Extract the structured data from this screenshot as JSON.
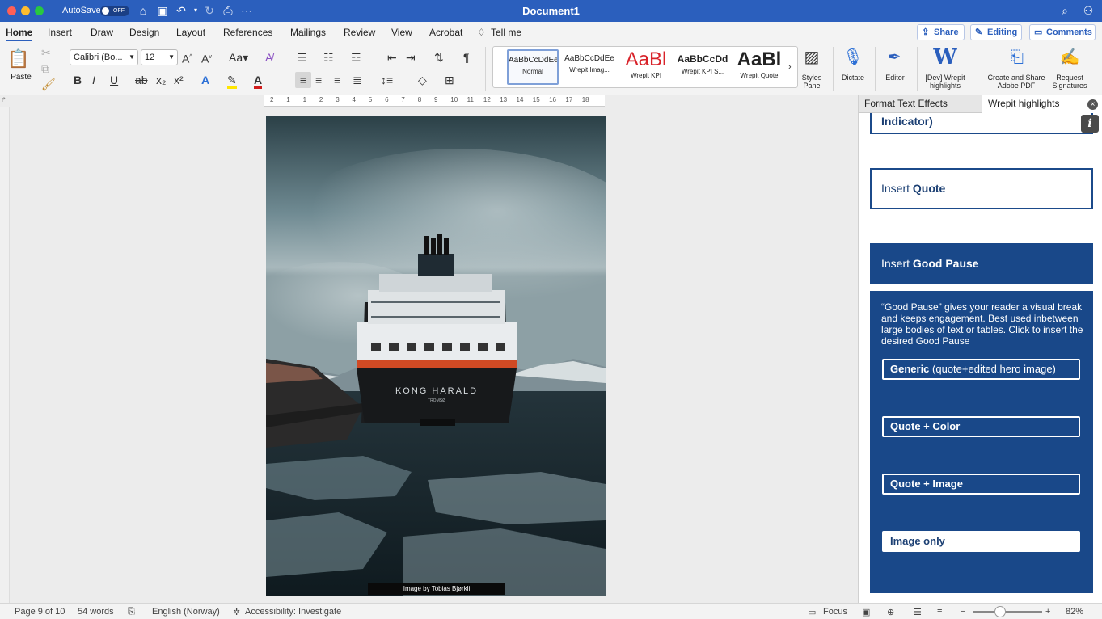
{
  "window": {
    "title": "Document1",
    "autosave_label": "AutoSave",
    "autosave_state": "OFF"
  },
  "ribbon_tabs": [
    "Home",
    "Insert",
    "Draw",
    "Design",
    "Layout",
    "References",
    "Mailings",
    "Review",
    "View",
    "Acrobat"
  ],
  "tell_me": "Tell me",
  "top_buttons": {
    "share": "Share",
    "editing": "Editing",
    "comments": "Comments"
  },
  "ribbon": {
    "paste": "Paste",
    "font_name": "Calibri (Bo...",
    "font_size": "12",
    "styles": [
      {
        "sample": "AaBbCcDdEe",
        "name": "Normal"
      },
      {
        "sample": "AaBbCcDdEe",
        "name": "Wrepit Imag..."
      },
      {
        "sample": "AaBl",
        "name": "Wrepit KPI"
      },
      {
        "sample": "AaBbCcDd",
        "name": "Wrepit KPI S..."
      },
      {
        "sample": "AaBl",
        "name": "Wrepit Quote"
      }
    ],
    "styles_pane": "Styles Pane",
    "dictate": "Dictate",
    "editor": "Editor",
    "dev_wrepit": "[Dev] Wrepit highlights",
    "create_pdf": "Create and Share Adobe PDF",
    "request_sig": "Request Signatures"
  },
  "ruler_numbers": [
    "2",
    "1",
    "1",
    "2",
    "3",
    "4",
    "5",
    "6",
    "7",
    "8",
    "9",
    "10",
    "11",
    "12",
    "13",
    "14",
    "15",
    "16",
    "17",
    "18"
  ],
  "document": {
    "ship_name": "KONG HARALD",
    "ship_port": "TROMSØ",
    "caption": "Image by Tobias Bjørkli"
  },
  "pane": {
    "tab_format": "Format Text Effects",
    "tab_wrepit": "Wrepit highlights",
    "indicator": "Indicator)",
    "quote_prefix": "Insert ",
    "quote_bold": "Quote",
    "pause_prefix": "Insert ",
    "pause_bold": "Good Pause",
    "description": "“Good Pause” gives your reader a visual break and keeps engagement. Best used inbetween large bodies of text or tables. Click to insert the desired Good Pause",
    "opt_generic_bold": "Generic",
    "opt_generic_rest": " (quote+edited hero image)",
    "opt_quote_color": "Quote + Color",
    "opt_quote_image": "Quote + Image",
    "opt_image_only": "Image only",
    "info": "i"
  },
  "status": {
    "page": "Page 9 of 10",
    "words": "54 words",
    "language": "English (Norway)",
    "accessibility": "Accessibility: Investigate",
    "focus": "Focus",
    "zoom": "82%",
    "zoom_level_percent": 82
  }
}
